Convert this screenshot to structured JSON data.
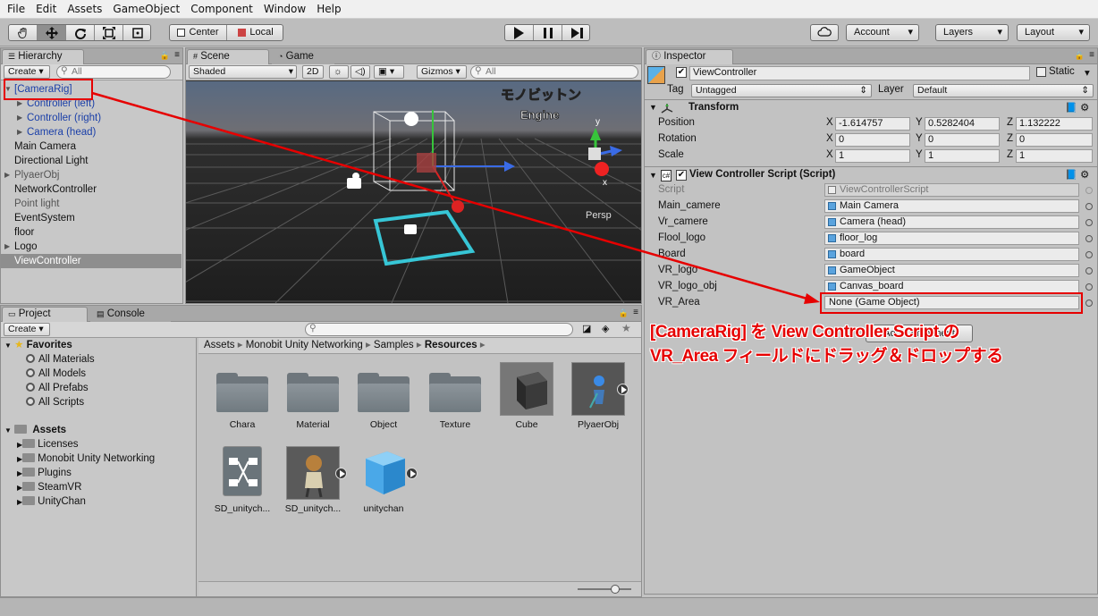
{
  "menu": [
    "File",
    "Edit",
    "Assets",
    "GameObject",
    "Component",
    "Window",
    "Help"
  ],
  "toolbar": {
    "pivot": "Center",
    "space": "Local",
    "account": "Account",
    "layers": "Layers",
    "layout": "Layout"
  },
  "hierarchy": {
    "tab": "Hierarchy",
    "create": "Create",
    "search_placeholder": "All",
    "items": [
      {
        "label": "[CameraRig]",
        "color": "#1a3fa8",
        "expand": "open",
        "indent": 0
      },
      {
        "label": "Controller (left)",
        "color": "#1a3fa8",
        "expand": "closed",
        "indent": 1
      },
      {
        "label": "Controller (right)",
        "color": "#1a3fa8",
        "expand": "closed",
        "indent": 1
      },
      {
        "label": "Camera (head)",
        "color": "#1a3fa8",
        "expand": "closed",
        "indent": 1
      },
      {
        "label": "Main Camera",
        "color": "#111111",
        "expand": "none",
        "indent": 0
      },
      {
        "label": "Directional Light",
        "color": "#111111",
        "expand": "none",
        "indent": 0
      },
      {
        "label": "PlyaerObj",
        "color": "#555555",
        "expand": "closed",
        "indent": 0
      },
      {
        "label": "NetworkController",
        "color": "#111111",
        "expand": "none",
        "indent": 0
      },
      {
        "label": "Point light",
        "color": "#555555",
        "expand": "none",
        "indent": 0
      },
      {
        "label": "EventSystem",
        "color": "#111111",
        "expand": "none",
        "indent": 0
      },
      {
        "label": "floor",
        "color": "#111111",
        "expand": "none",
        "indent": 0
      },
      {
        "label": "Logo",
        "color": "#111111",
        "expand": "closed",
        "indent": 0
      },
      {
        "label": "ViewController",
        "color": "#ffffff",
        "expand": "none",
        "indent": 0,
        "selected": true
      }
    ]
  },
  "scene": {
    "tab_scene": "Scene",
    "tab_game": "Game",
    "shading": "Shaded",
    "mode_2d": "2D",
    "gizmos": "Gizmos",
    "search_placeholder": "All",
    "persp": "Persp",
    "axis_y": "y",
    "axis_x": "x"
  },
  "inspector": {
    "tab": "Inspector",
    "object_name": "ViewController",
    "static": "Static",
    "tag_label": "Tag",
    "tag_value": "Untagged",
    "layer_label": "Layer",
    "layer_value": "Default",
    "transform": {
      "title": "Transform",
      "rows": [
        {
          "label": "Position",
          "x": "-1.614757",
          "y": "0.5282404",
          "z": "1.132222"
        },
        {
          "label": "Rotation",
          "x": "0",
          "y": "0",
          "z": "0"
        },
        {
          "label": "Scale",
          "x": "1",
          "y": "1",
          "z": "1"
        }
      ]
    },
    "script": {
      "title": "View Controller Script (Script)",
      "script_label": "Script",
      "script_value": "ViewControllerScript",
      "fields": [
        {
          "label": "Main_camere",
          "value": "Main Camera"
        },
        {
          "label": "Vr_camere",
          "value": "Camera (head)"
        },
        {
          "label": "Flool_logo",
          "value": "floor_log"
        },
        {
          "label": "Board",
          "value": "board"
        },
        {
          "label": "VR_logo",
          "value": "GameObject"
        },
        {
          "label": "VR_logo_obj",
          "value": "Canvas_board"
        },
        {
          "label": "VR_Area",
          "value": "None (Game Object)"
        }
      ]
    },
    "add_component": "Add Component"
  },
  "project": {
    "tab_project": "Project",
    "tab_console": "Console",
    "create": "Create",
    "favorites": "Favorites",
    "fav_items": [
      "All Materials",
      "All Models",
      "All Prefabs",
      "All Scripts"
    ],
    "assets": "Assets",
    "asset_folders": [
      "Licenses",
      "Monobit Unity Networking",
      "Plugins",
      "SteamVR",
      "UnityChan"
    ],
    "breadcrumb": [
      "Assets",
      "Monobit Unity Networking",
      "Samples",
      "Resources"
    ],
    "items": [
      "Chara",
      "Material",
      "Object",
      "Texture",
      "Cube",
      "PlyaerObj",
      "SD_unitych...",
      "SD_unitych...",
      "unitychan"
    ],
    "slider_value": 0.7
  },
  "annotation": {
    "line1": "[CameraRig] を View Controller Script の",
    "line2": "VR_Area フィールドにドラッグ＆ドロップする",
    "color": "#e60000"
  }
}
